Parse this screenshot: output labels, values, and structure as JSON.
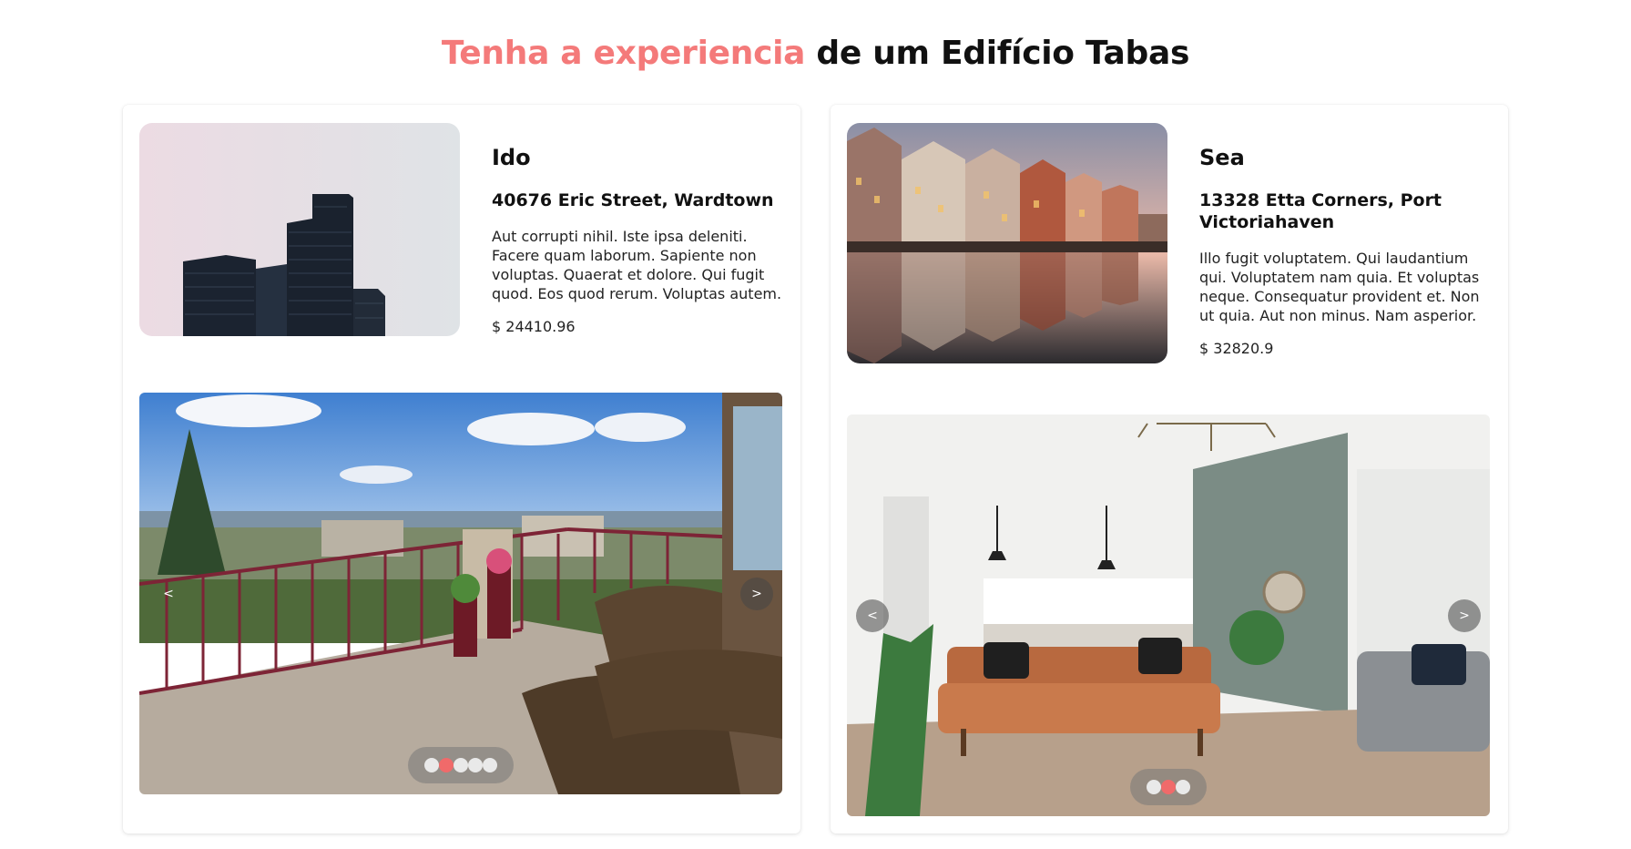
{
  "header": {
    "title_accent": "Tenha a experiencia",
    "title_rest": " de um Edifício Tabas",
    "accent_color": "#f47a7a"
  },
  "listings": [
    {
      "name": "Ido",
      "address": "40676 Eric Street, Wardtown",
      "description": "Aut corrupti nihil. Iste ipsa deleniti. Facere quam laborum. Sapiente non voluptas. Quaerat et dolore. Qui fugit quod. Eos quod rerum. Voluptas autem.",
      "price": "$ 24410.96",
      "carousel": {
        "prev_label": "<",
        "next_label": ">",
        "slide_count": 5,
        "active_slide": 1
      }
    },
    {
      "name": "Sea",
      "address": "13328 Etta Corners, Port Victoriahaven",
      "description": "Illo fugit voluptatem. Qui laudantium qui. Voluptatem nam quia. Et voluptas neque. Consequatur provident et. Non ut quia. Aut non minus. Nam asperior.",
      "price": "$ 32820.9",
      "carousel": {
        "prev_label": "<",
        "next_label": ">",
        "slide_count": 3,
        "active_slide": 1
      }
    }
  ]
}
